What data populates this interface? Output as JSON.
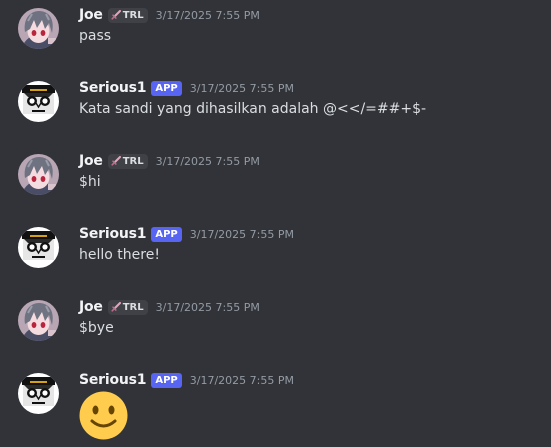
{
  "users": {
    "joe": {
      "name": "Joe",
      "tag": "TRL",
      "tag_icon": "sword-icon"
    },
    "serious1": {
      "name": "Serious1",
      "badge": "APP"
    }
  },
  "messages": [
    {
      "author": "Joe",
      "tag": "TRL",
      "timestamp": "3/17/2025 7:55 PM",
      "content": "pass"
    },
    {
      "author": "Serious1",
      "badge": "APP",
      "timestamp": "3/17/2025 7:55 PM",
      "content": "Kata sandi yang dihasilkan adalah @<</=##+$-"
    },
    {
      "author": "Joe",
      "tag": "TRL",
      "timestamp": "3/17/2025 7:55 PM",
      "content": "$hi"
    },
    {
      "author": "Serious1",
      "badge": "APP",
      "timestamp": "3/17/2025 7:55 PM",
      "content": "hello there!"
    },
    {
      "author": "Joe",
      "tag": "TRL",
      "timestamp": "3/17/2025 7:55 PM",
      "content": "$bye"
    },
    {
      "author": "Serious1",
      "badge": "APP",
      "timestamp": "3/17/2025 7:55 PM",
      "content_emoji": "slightly-smiling-face-emoji"
    }
  ],
  "colors": {
    "background": "#313338",
    "username": "#f2f3f5",
    "message_text": "#dbdee1",
    "timestamp": "#949ba4",
    "app_badge": "#5865f2",
    "role_tag_bg": "#3f4147",
    "emoji_yellow": "#ffcc4d"
  }
}
